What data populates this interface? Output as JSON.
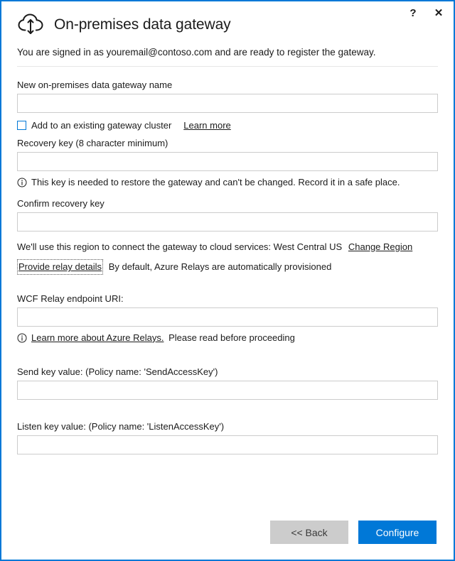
{
  "window": {
    "border_color": "#0078d7",
    "help_label": "?",
    "close_label": "✕"
  },
  "header": {
    "icon": "cloud-upload-download-icon",
    "title": "On-premises data gateway",
    "signin_text": "You are signed in as youremail@contoso.com and are ready to register the gateway."
  },
  "form": {
    "gateway_name": {
      "label": "New on-premises data gateway name",
      "value": "",
      "placeholder": ""
    },
    "cluster_checkbox": {
      "label": "Add to an existing gateway cluster",
      "checked": false,
      "link_label": "Learn more"
    },
    "recovery_key": {
      "label": "Recovery key (8 character minimum)",
      "value": "",
      "placeholder": "",
      "info_icon": "info-circle-icon",
      "info_text": "This key is needed to restore the gateway and can't be changed. Record it in a safe place."
    },
    "confirm_recovery_key": {
      "label": "Confirm recovery key",
      "value": "",
      "placeholder": ""
    },
    "region": {
      "text": "We'll use this region to connect the gateway to cloud services: West Central US",
      "region_name": "West Central US",
      "link_label": "Change Region"
    },
    "relay_details": {
      "link_label": "Provide relay details",
      "focused": true,
      "description": "By default, Azure Relays are automatically provisioned"
    },
    "wcf_relay_uri": {
      "label": "WCF Relay endpoint URI:",
      "value": "",
      "placeholder": "",
      "info_icon": "info-circle-icon",
      "link_label": "Learn more about Azure Relays.",
      "info_text": "Please read before proceeding"
    },
    "send_key": {
      "label": "Send key value: (Policy name: 'SendAccessKey')",
      "value": "",
      "placeholder": ""
    },
    "listen_key": {
      "label": "Listen key value: (Policy name: 'ListenAccessKey')",
      "value": "",
      "placeholder": ""
    }
  },
  "footer": {
    "back_label": "<< Back",
    "configure_label": "Configure",
    "primary_color": "#0078d7",
    "secondary_color": "#cccccc"
  }
}
